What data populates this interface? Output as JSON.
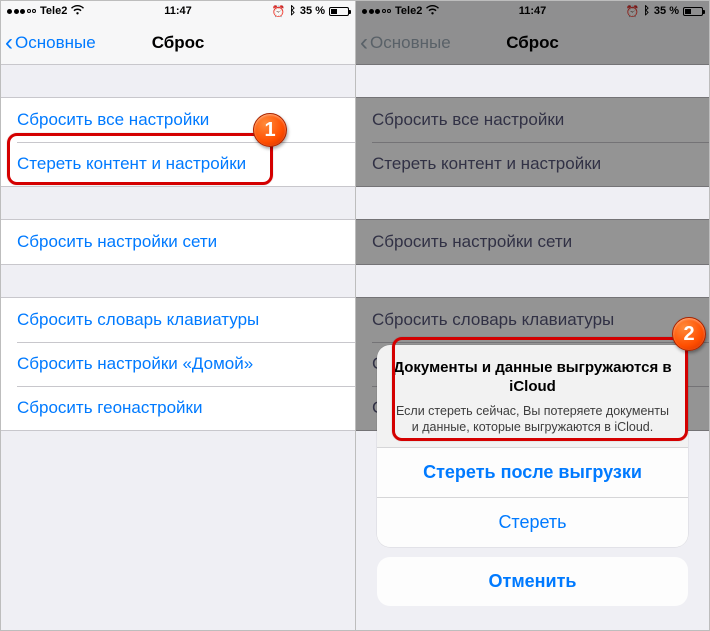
{
  "statusbar": {
    "carrier": "Tele2",
    "time": "11:47",
    "alarm_icon": "⏰",
    "bluetooth_icon": "ᛒ",
    "battery_pct": "35 %"
  },
  "nav": {
    "back_label": "Основные",
    "title": "Сброс"
  },
  "left": {
    "group1": [
      "Сбросить все настройки",
      "Стереть контент и настройки"
    ],
    "group2": [
      "Сбросить настройки сети"
    ],
    "group3": [
      "Сбросить словарь клавиатуры",
      "Сбросить настройки «Домой»",
      "Сбросить геонастройки"
    ]
  },
  "right": {
    "group1": [
      "Сбросить все настройки",
      "Стереть контент и настройки"
    ],
    "group2": [
      "Сбросить настройки сети"
    ],
    "group3": [
      "Сбросить словарь клавиатуры",
      "Сбросить настройки «Домой»",
      "Сбросить геонастройки"
    ]
  },
  "sheet": {
    "title": "Документы и данные выгружаются в iCloud",
    "body": "Если стереть сейчас, Вы потеряете документы и данные, которые выгружаются в iCloud.",
    "primary": "Стереть после выгрузки",
    "secondary": "Стереть",
    "cancel": "Отменить"
  },
  "callouts": {
    "one": "1",
    "two": "2"
  }
}
